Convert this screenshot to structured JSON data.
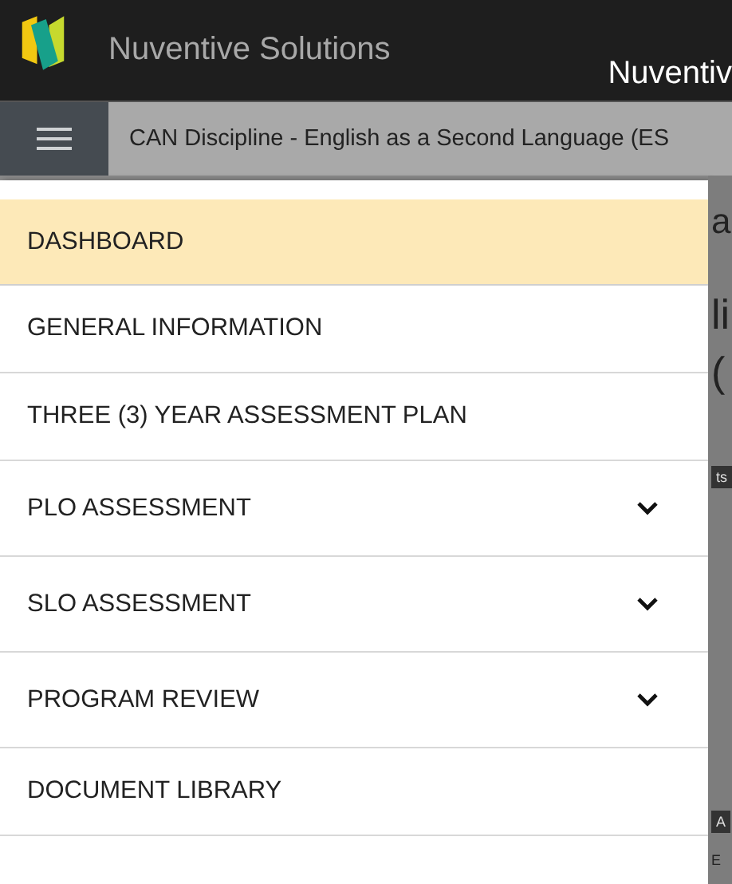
{
  "header": {
    "brand": "Nuventive Solutions",
    "title": "Nuventiv"
  },
  "breadcrumb": "CAN Discipline - English as a Second Language (ES",
  "menu": [
    {
      "label": "DASHBOARD",
      "selected": true,
      "expandable": false
    },
    {
      "label": "GENERAL INFORMATION",
      "selected": false,
      "expandable": false
    },
    {
      "label": "THREE (3) YEAR ASSESSMENT PLAN",
      "selected": false,
      "expandable": false
    },
    {
      "label": "PLO ASSESSMENT",
      "selected": false,
      "expandable": true
    },
    {
      "label": "SLO ASSESSMENT",
      "selected": false,
      "expandable": true
    },
    {
      "label": "PROGRAM REVIEW",
      "selected": false,
      "expandable": true
    },
    {
      "label": "DOCUMENT LIBRARY",
      "selected": false,
      "expandable": false
    }
  ],
  "background_fragments": [
    {
      "text": "a",
      "kind": "heading"
    },
    {
      "text": "li",
      "kind": "title"
    },
    {
      "text": "(",
      "kind": "title"
    },
    {
      "text": "ts",
      "kind": "tab"
    },
    {
      "text": "A",
      "kind": "tab"
    },
    {
      "text": "E",
      "kind": "small"
    }
  ]
}
